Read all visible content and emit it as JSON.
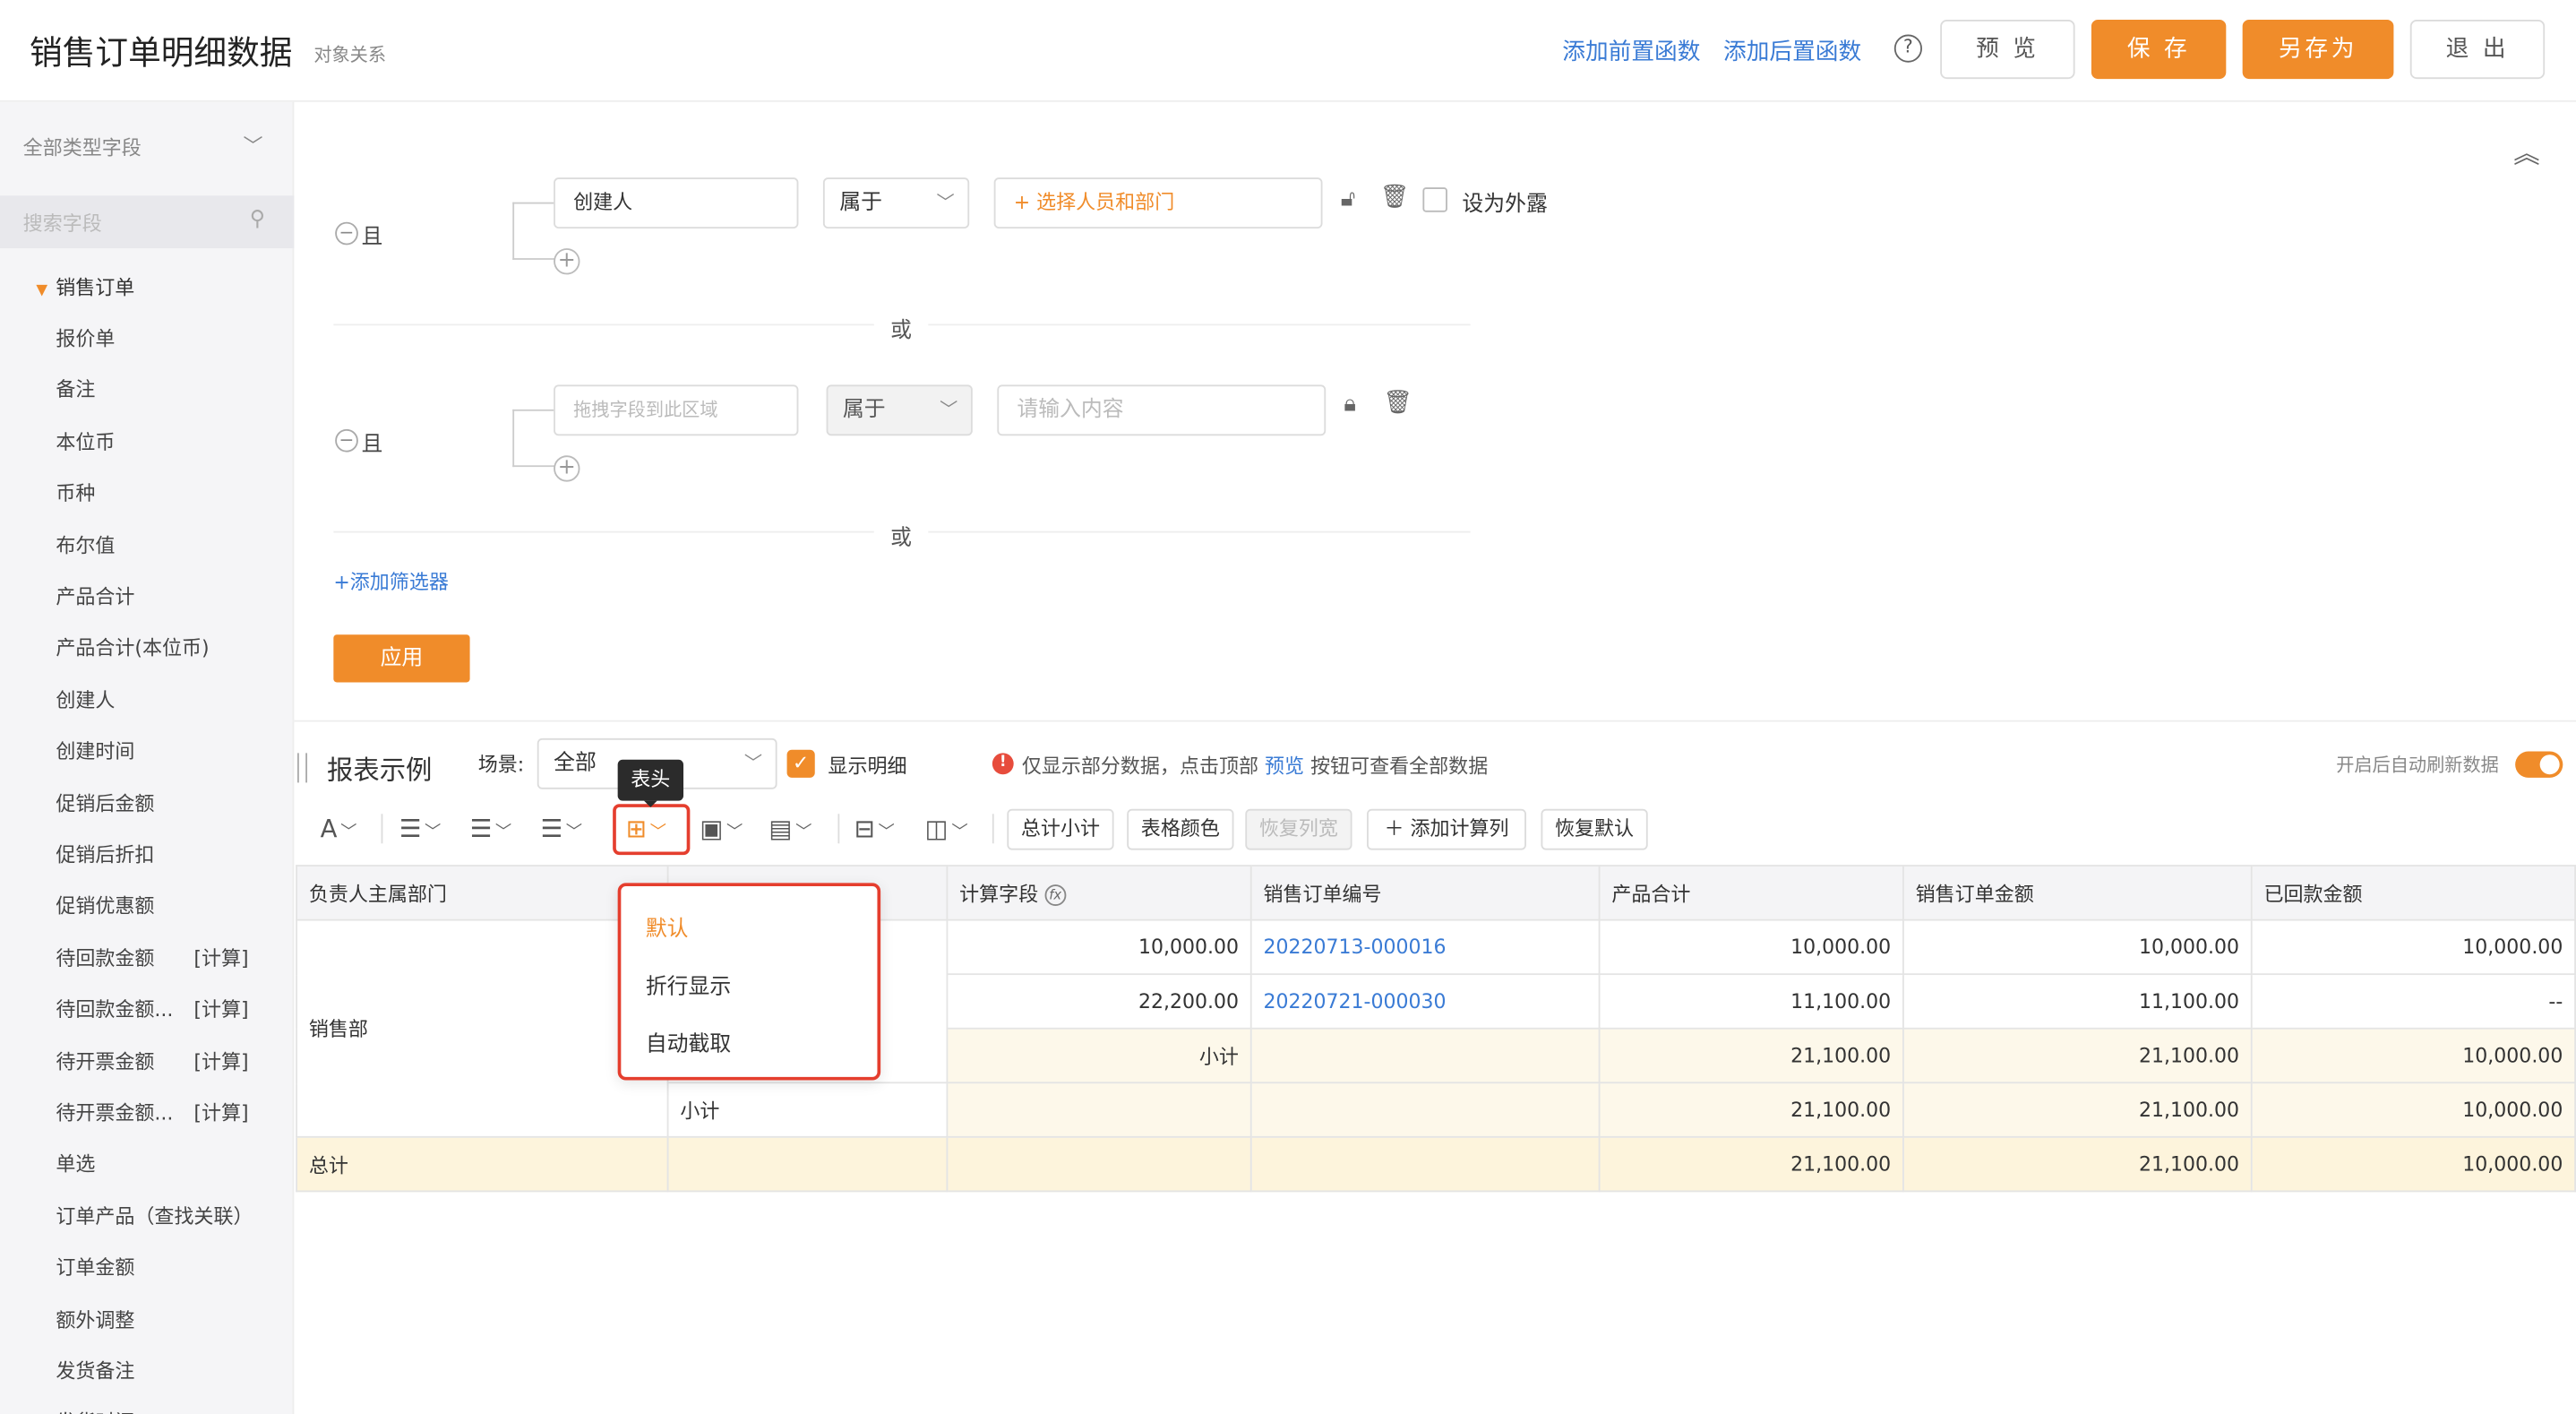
{
  "header": {
    "title": "销售订单明细数据",
    "subtitle": "对象关系",
    "add_pre_func": "添加前置函数",
    "add_post_func": "添加后置函数",
    "help": "?",
    "preview": "预 览",
    "save": "保 存",
    "save_as": "另存为",
    "exit": "退 出"
  },
  "sidebar": {
    "type_select": "全部类型字段",
    "search_placeholder": "搜索字段",
    "root": "销售订单",
    "items": [
      {
        "label": "报价单",
        "tag": ""
      },
      {
        "label": "备注",
        "tag": ""
      },
      {
        "label": "本位币",
        "tag": ""
      },
      {
        "label": "币种",
        "tag": ""
      },
      {
        "label": "布尔值",
        "tag": ""
      },
      {
        "label": "产品合计",
        "tag": ""
      },
      {
        "label": "产品合计(本位币)",
        "tag": ""
      },
      {
        "label": "创建人",
        "tag": ""
      },
      {
        "label": "创建时间",
        "tag": ""
      },
      {
        "label": "促销后金额",
        "tag": ""
      },
      {
        "label": "促销后折扣",
        "tag": ""
      },
      {
        "label": "促销优惠额",
        "tag": ""
      },
      {
        "label": "待回款金额",
        "tag": "[计算]"
      },
      {
        "label": "待回款金额...",
        "tag": "[计算]"
      },
      {
        "label": "待开票金额",
        "tag": "[计算]"
      },
      {
        "label": "待开票金额...",
        "tag": "[计算]"
      },
      {
        "label": "单选",
        "tag": ""
      },
      {
        "label": "订单产品（查找关联）",
        "tag": ""
      },
      {
        "label": "订单金额",
        "tag": ""
      },
      {
        "label": "额外调整",
        "tag": ""
      },
      {
        "label": "发货备注",
        "tag": ""
      },
      {
        "label": "发货时间",
        "tag": ""
      }
    ]
  },
  "filters": {
    "and_label": "且",
    "or_label": "或",
    "group1": {
      "field": "创建人",
      "operator": "属于",
      "value_placeholder": "+ 选择人员和部门",
      "expose_label": "设为外露"
    },
    "group2": {
      "field_placeholder": "拖拽字段到此区域",
      "operator": "属于",
      "value_placeholder": "请输入内容"
    },
    "add_filter": "+添加筛选器",
    "apply": "应用"
  },
  "report": {
    "title": "报表示例",
    "scene_label": "场景:",
    "scene_value": "全部",
    "show_detail": "显示明细",
    "notice_pre": "仅显示部分数据，点击顶部",
    "notice_link": "预览",
    "notice_post": "按钮可查看全部数据",
    "auto_refresh": "开启后自动刷新数据",
    "auto_refresh_on": true,
    "toolbar": {
      "font_icon": "A",
      "total_subtotal": "总计小计",
      "table_color": "表格颜色",
      "restore_width": "恢复列宽",
      "add_calc_col": "添加计算列",
      "restore_default": "恢复默认",
      "tooltip": "表头"
    },
    "dropdown": {
      "items": [
        "默认",
        "折行显示",
        "自动截取"
      ],
      "selected": "默认"
    },
    "table": {
      "headers": [
        "负责人主属部门",
        "",
        "计算字段",
        "销售订单编号",
        "产品合计",
        "销售订单金额",
        "已回款金额"
      ],
      "dept": "销售部",
      "rows": [
        {
          "calc": "10,000.00",
          "order_no": "20220713-000016",
          "product_total": "10,000.00",
          "order_amount": "10,000.00",
          "received": "10,000.00"
        },
        {
          "calc": "22,200.00",
          "order_no": "20220721-000030",
          "product_total": "11,100.00",
          "order_amount": "11,100.00",
          "received": "--"
        }
      ],
      "subtotal_inner": {
        "label": "小计",
        "product_total": "21,100.00",
        "order_amount": "21,100.00",
        "received": "10,000.00"
      },
      "subtotal_outer": {
        "label": "小计",
        "product_total": "21,100.00",
        "order_amount": "21,100.00",
        "received": "10,000.00"
      },
      "total": {
        "label": "总计",
        "product_total": "21,100.00",
        "order_amount": "21,100.00",
        "received": "10,000.00"
      }
    }
  },
  "colors": {
    "accent": "#f08c2a",
    "link": "#3a7bd5",
    "highlight": "#e53e2e"
  }
}
